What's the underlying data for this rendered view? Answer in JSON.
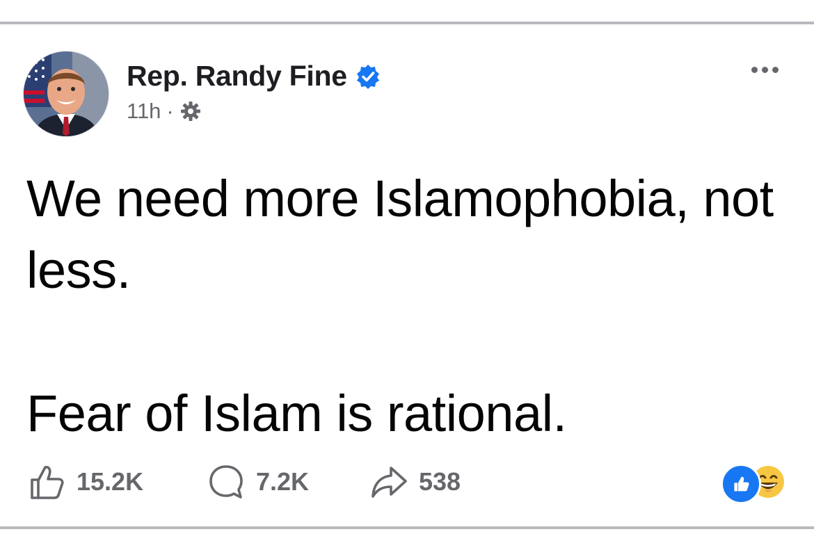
{
  "post": {
    "author": "Rep. Randy Fine",
    "time": "11h",
    "separator": "·",
    "lines": [
      "We need more Islamophobia, not less.",
      "Fear of Islam is rational."
    ],
    "icons": {
      "avatar": "profile-photo",
      "verified": "verified-badge-icon",
      "audience": "public-gear-icon",
      "more": "more-options-icon"
    }
  },
  "stats": {
    "likes": "15.2K",
    "comments": "7.2K",
    "shares": "538",
    "reactions": [
      "like",
      "haha"
    ]
  },
  "colors": {
    "verified_blue": "#1877f2",
    "meta_gray": "#65676b",
    "text": "#050505",
    "rule": "#b8babd"
  }
}
